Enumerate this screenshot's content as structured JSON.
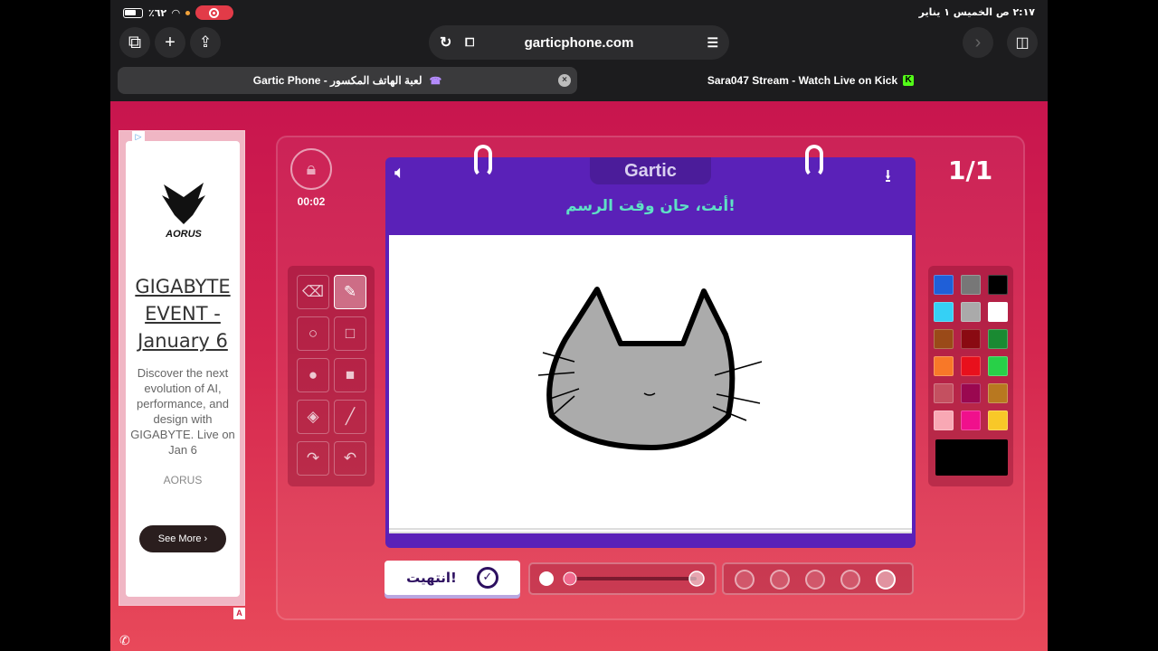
{
  "status_bar": {
    "time": "٢:١٧ ص  الخميس ١ يناير",
    "battery": "٪٦٢"
  },
  "browser": {
    "url": "garticphone.com",
    "tabs": [
      {
        "label": "Gartic Phone - لعبة الهاتف المكسور",
        "active": true
      },
      {
        "label": "Sara047 Stream - Watch Live on Kick",
        "active": false
      }
    ]
  },
  "ad": {
    "brand_logo_text": "AORUS",
    "title": "GIGABYTE EVENT - January 6",
    "description": "Discover the next evolution of AI, performance, and design with GIGABYTE. Live on Jan 6",
    "brand": "AORUS",
    "button": "See More"
  },
  "game": {
    "timer": "00:02",
    "round": "1/1",
    "logo": "Gartic",
    "prompt": "أنت، حان وقت الرسم!",
    "done_button": "انتهيت!",
    "tools": [
      "eraser-icon",
      "pencil-icon",
      "circle-outline-icon",
      "square-outline-icon",
      "circle-fill-icon",
      "square-fill-icon",
      "bucket-icon",
      "line-icon",
      "redo-icon",
      "undo-icon"
    ],
    "selected_tool": "pencil-icon",
    "palette": [
      "#1f5fd8",
      "#777777",
      "#000000",
      "#35d0f5",
      "#aaaaaa",
      "#ffffff",
      "#9a4a18",
      "#8a0a12",
      "#1a8a32",
      "#f87828",
      "#e8101c",
      "#28d048",
      "#c45060",
      "#9a0850",
      "#b87820",
      "#f8a8b4",
      "#f0108c",
      "#f8c828"
    ],
    "current_color": "#000000",
    "brush_sizes": 5
  }
}
